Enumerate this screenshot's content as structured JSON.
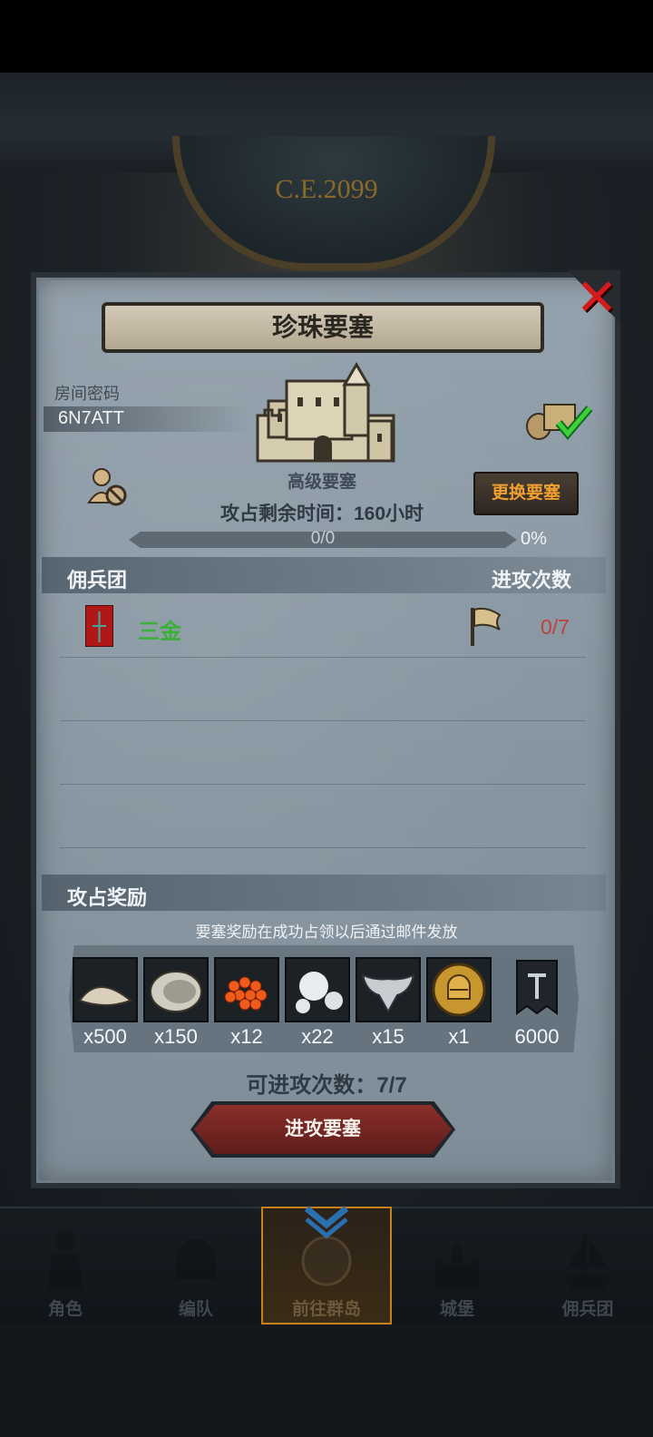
{
  "background": {
    "era_label": "C.E.2099"
  },
  "panel": {
    "title": "珍珠要塞",
    "room_label": "房间密码",
    "room_code": "6N7ATT",
    "fortress_level": "高级要塞",
    "change_button": "更换要塞",
    "time_label": "攻占剩余时间：",
    "time_value": "160",
    "time_unit": "小时",
    "progress_text": "0/0",
    "progress_percent": "0%",
    "progress_value": 0
  },
  "mercenary_section": {
    "title": "佣兵团",
    "count_header": "进攻次数",
    "rows": [
      {
        "name": "三金",
        "attacks": "0/7"
      }
    ]
  },
  "reward_section": {
    "title": "攻占奖励",
    "note": "要塞奖励在成功占领以后通过邮件发放",
    "items": [
      {
        "icon": "sand-pile-icon",
        "qty": "x500"
      },
      {
        "icon": "oyster-icon",
        "qty": "x150"
      },
      {
        "icon": "roe-icon",
        "qty": "x12"
      },
      {
        "icon": "pearl-icon",
        "qty": "x22"
      },
      {
        "icon": "winged-emblem-icon",
        "qty": "x15"
      },
      {
        "icon": "golden-helmet-coin-icon",
        "qty": "x1"
      },
      {
        "icon": "guild-banner-icon",
        "qty": "6000"
      }
    ],
    "attacks_label": "可进攻次数：",
    "attacks_value": "7/7",
    "attack_button": "进攻要塞"
  },
  "nav": {
    "items": [
      {
        "label": "角色",
        "icon": "knight-icon"
      },
      {
        "label": "编队",
        "icon": "helmet-icon"
      },
      {
        "label": "前往群岛",
        "icon": "globe-icon",
        "active": true
      },
      {
        "label": "城堡",
        "icon": "castle-icon"
      },
      {
        "label": "佣兵团",
        "icon": "ship-icon"
      }
    ]
  },
  "colors": {
    "accent_gold": "#c8821a",
    "attack_red": "#8a2f2b",
    "merc_green": "#3ab038",
    "count_red": "#c04040",
    "close_red": "#d41a1a"
  }
}
